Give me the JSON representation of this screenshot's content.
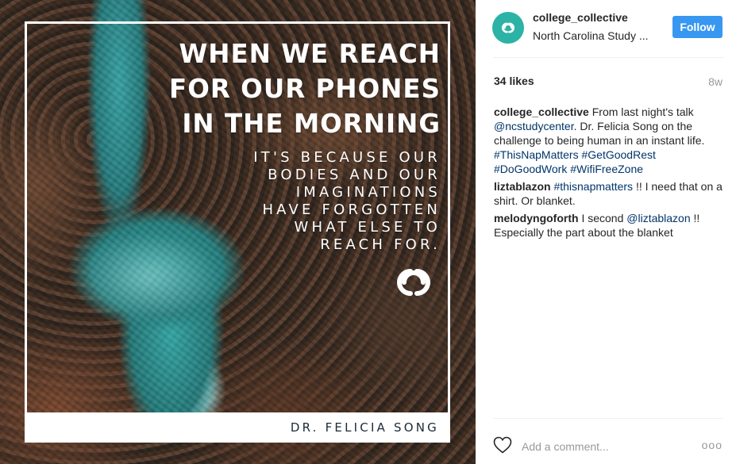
{
  "post_image": {
    "headline_lines": [
      "WHEN WE REACH",
      "FOR OUR PHONES",
      "IN THE MORNING"
    ],
    "subtext_lines": [
      "IT'S BECAUSE OUR",
      "BODIES AND OUR",
      "IMAGINATIONS",
      "HAVE FORGOTTEN",
      "WHAT ELSE TO",
      "REACH FOR."
    ],
    "author": "DR. FELICIA SONG",
    "logo_icon": "link-rings-icon"
  },
  "header": {
    "username": "college_collective",
    "location": "North Carolina Study ...",
    "follow_label": "Follow",
    "avatar_icon": "link-rings-icon"
  },
  "stats": {
    "likes": "34 likes",
    "time_ago": "8w"
  },
  "comments": [
    {
      "user": "college_collective",
      "parts": [
        {
          "t": "From last night's talk "
        },
        {
          "t": "@ncstudycenter",
          "tag": true
        },
        {
          "t": ". Dr. Felicia Song on the challenge to being human in an instant life. "
        },
        {
          "t": "#ThisNapMatters",
          "tag": true
        },
        {
          "t": " "
        },
        {
          "t": "#GetGoodRest",
          "tag": true
        },
        {
          "t": " "
        },
        {
          "t": "#DoGoodWork",
          "tag": true
        },
        {
          "t": " "
        },
        {
          "t": "#WifiFreeZone",
          "tag": true
        }
      ]
    },
    {
      "user": "liztablazon",
      "parts": [
        {
          "t": "#thisnapmatters",
          "tag": true
        },
        {
          "t": " !! I need that on a shirt. Or blanket."
        }
      ]
    },
    {
      "user": "melodyngoforth",
      "parts": [
        {
          "t": "I second "
        },
        {
          "t": "@liztablazon",
          "tag": true
        },
        {
          "t": " !! Especially the part about the blanket"
        }
      ]
    }
  ],
  "footer": {
    "add_comment_placeholder": "Add a comment...",
    "more_label": "ooo",
    "like_icon": "heart-icon"
  },
  "colors": {
    "accent": "#3897f0",
    "avatar_bg": "#2bb3a5",
    "hashtag": "#003569",
    "muted": "#999999"
  }
}
